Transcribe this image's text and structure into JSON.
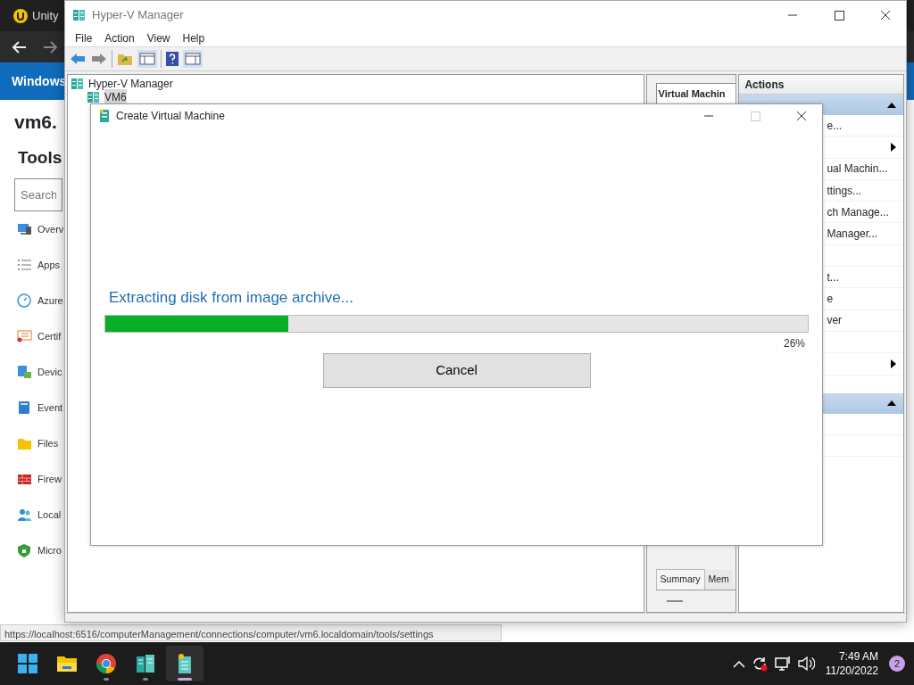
{
  "browser": {
    "tab_title": "Unity",
    "banner_title": "Windows",
    "heading": "vm6.",
    "section_title": "Tools",
    "search": {
      "placeholder": "Search"
    },
    "tools": [
      {
        "kind": "overview",
        "label": "Overv"
      },
      {
        "kind": "apps",
        "label": "Apps"
      },
      {
        "kind": "azure",
        "label": "Azure"
      },
      {
        "kind": "certificates",
        "label": "Certif"
      },
      {
        "kind": "devices",
        "label": "Devic"
      },
      {
        "kind": "events",
        "label": "Event"
      },
      {
        "kind": "files",
        "label": "Files"
      },
      {
        "kind": "firewall",
        "label": "Firew"
      },
      {
        "kind": "users",
        "label": "Local"
      },
      {
        "kind": "defender",
        "label": "Micro"
      }
    ],
    "status_url": "https://localhost:6516/computerManagement/connections/computer/vm6.localdomain/tools/settings"
  },
  "hyperv_window": {
    "title": "Hyper-V Manager",
    "menu": [
      "File",
      "Action",
      "View",
      "Help"
    ],
    "tree": [
      {
        "label": "Hyper-V Manager",
        "selected": false,
        "children": [
          {
            "label": "VM6",
            "selected": true
          }
        ]
      }
    ],
    "center_pane": {
      "header": "Virtual Machin",
      "tabs": [
        {
          "label": "Summary",
          "selected": true
        },
        {
          "label": "Mem",
          "selected": false
        }
      ]
    },
    "actions": {
      "title": "Actions",
      "sections": [
        {
          "expanded": true,
          "items": [
            {
              "label": "e...",
              "submenu": false
            },
            {
              "submenu": true
            },
            {
              "label": "ual Machin...",
              "submenu": false
            },
            {
              "label": "ttings...",
              "submenu": false
            },
            {
              "label": "ch Manage...",
              "submenu": false
            },
            {
              "label": "Manager...",
              "submenu": false
            },
            {
              "submenu": false
            },
            {
              "label": "t...",
              "submenu": false
            },
            {
              "label": "e",
              "submenu": false
            },
            {
              "label": "ver",
              "submenu": false
            },
            {
              "submenu": false
            },
            {
              "submenu": true
            }
          ]
        },
        {
          "expanded": true,
          "items": [
            {
              "submenu": false
            },
            {
              "submenu": false
            }
          ]
        }
      ]
    }
  },
  "dialog": {
    "title": "Create Virtual Machine",
    "message": "Extracting disk from image archive...",
    "progress": {
      "level": 0.26,
      "reading": "26%"
    },
    "buttons": [
      "Cancel"
    ]
  },
  "taskbar": {
    "apps": [
      {
        "kind": "start",
        "running": false,
        "selected": false
      },
      {
        "kind": "explorer",
        "running": false,
        "selected": false
      },
      {
        "kind": "chrome",
        "running": true,
        "selected": false
      },
      {
        "kind": "server",
        "running": true,
        "selected": false
      },
      {
        "kind": "hyperv",
        "running": true,
        "selected": true
      }
    ],
    "time": "7:49 AM",
    "date": "11/20/2022",
    "notification_count": "2"
  }
}
